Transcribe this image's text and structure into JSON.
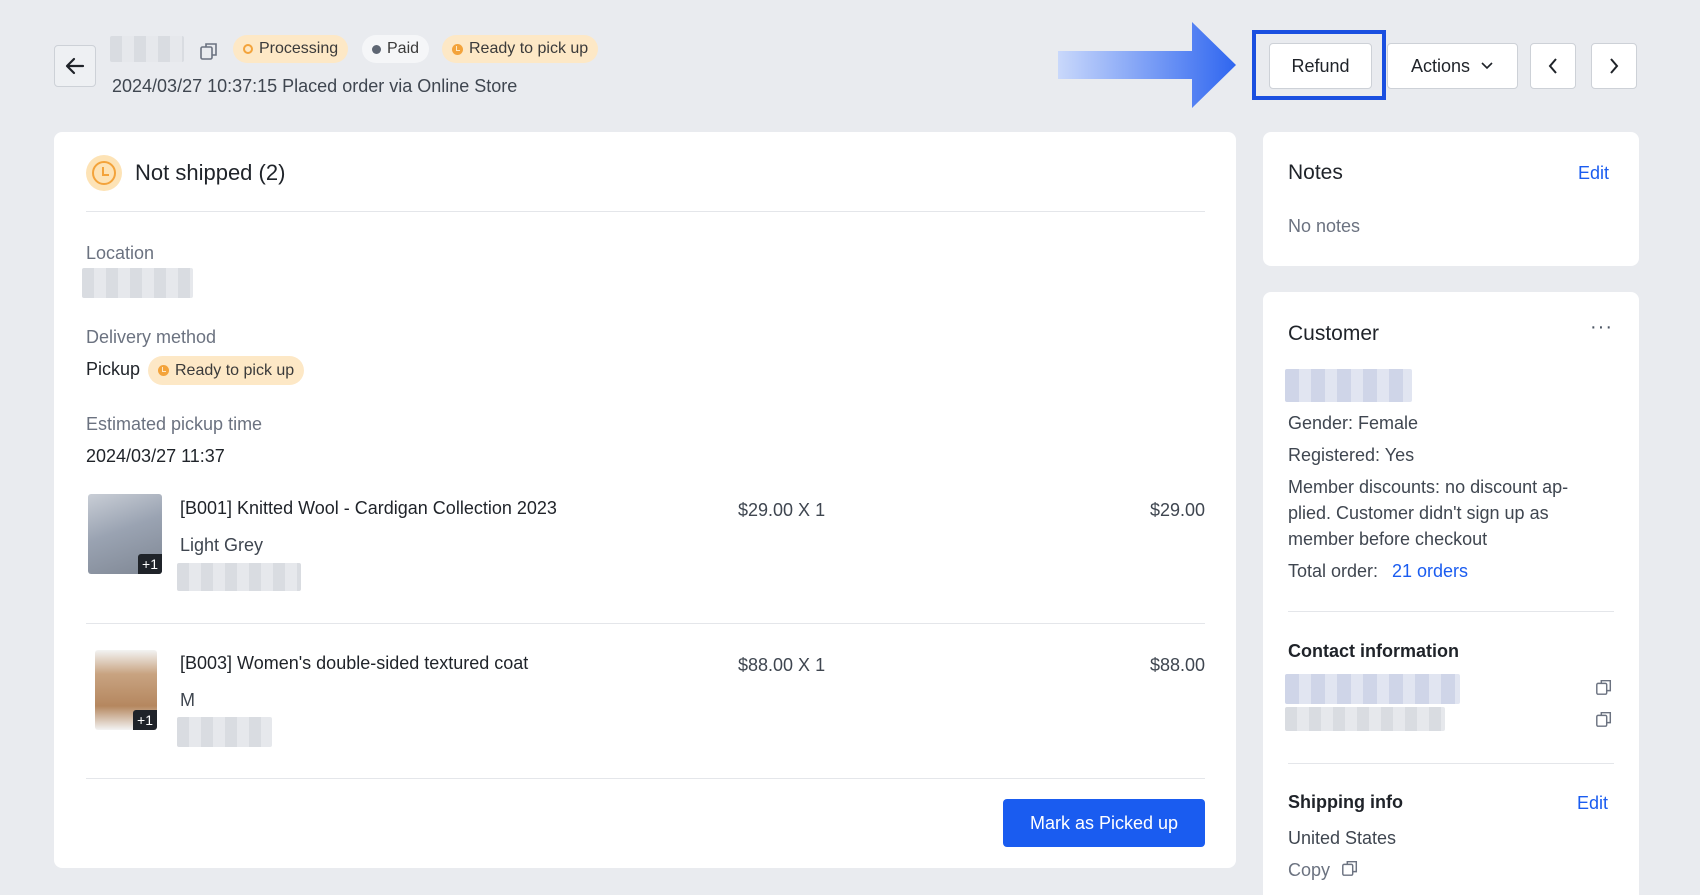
{
  "header": {
    "badges": {
      "processing": "Processing",
      "paid": "Paid",
      "ready": "Ready to pick up"
    },
    "placed_text": "2024/03/27 10:37:15 Placed order via Online Store",
    "buttons": {
      "refund": "Refund",
      "actions": "Actions"
    }
  },
  "shipment": {
    "title": "Not shipped (2)",
    "location_label": "Location",
    "delivery_label": "Delivery method",
    "delivery_value": "Pickup",
    "delivery_badge": "Ready to pick up",
    "pickup_time_label": "Estimated pickup time",
    "pickup_time_value": "2024/03/27 11:37",
    "items": [
      {
        "name": "[B001] Knitted Wool - Cardigan Collection 2023",
        "variant": "Light Grey",
        "unit": "$29.00 X 1",
        "total": "$29.00",
        "more": "+1"
      },
      {
        "name": "[B003] Women's double-sided textured coat",
        "variant": "M",
        "unit": "$88.00 X 1",
        "total": "$88.00",
        "more": "+1"
      }
    ],
    "primary_button": "Mark as Picked up"
  },
  "notes": {
    "title": "Notes",
    "edit": "Edit",
    "empty": "No notes"
  },
  "customer": {
    "title": "Customer",
    "more": "···",
    "gender": "Gender: Female",
    "registered": "Registered: Yes",
    "member_line1": "Member discounts: no discount ap-",
    "member_line2": "plied. Customer didn't sign up as",
    "member_line3": "member before checkout",
    "total_order_label": "Total order:",
    "total_order_link": "21 orders",
    "contact_title": "Contact information",
    "shipping_title": "Shipping info",
    "shipping_edit": "Edit",
    "shipping_country": "United States",
    "copy_label": "Copy"
  },
  "colors": {
    "accent": "#1a5cf0",
    "highlight": "#1a4fe0",
    "warning_bg": "#fde8c6",
    "warning": "#f3a33b"
  }
}
